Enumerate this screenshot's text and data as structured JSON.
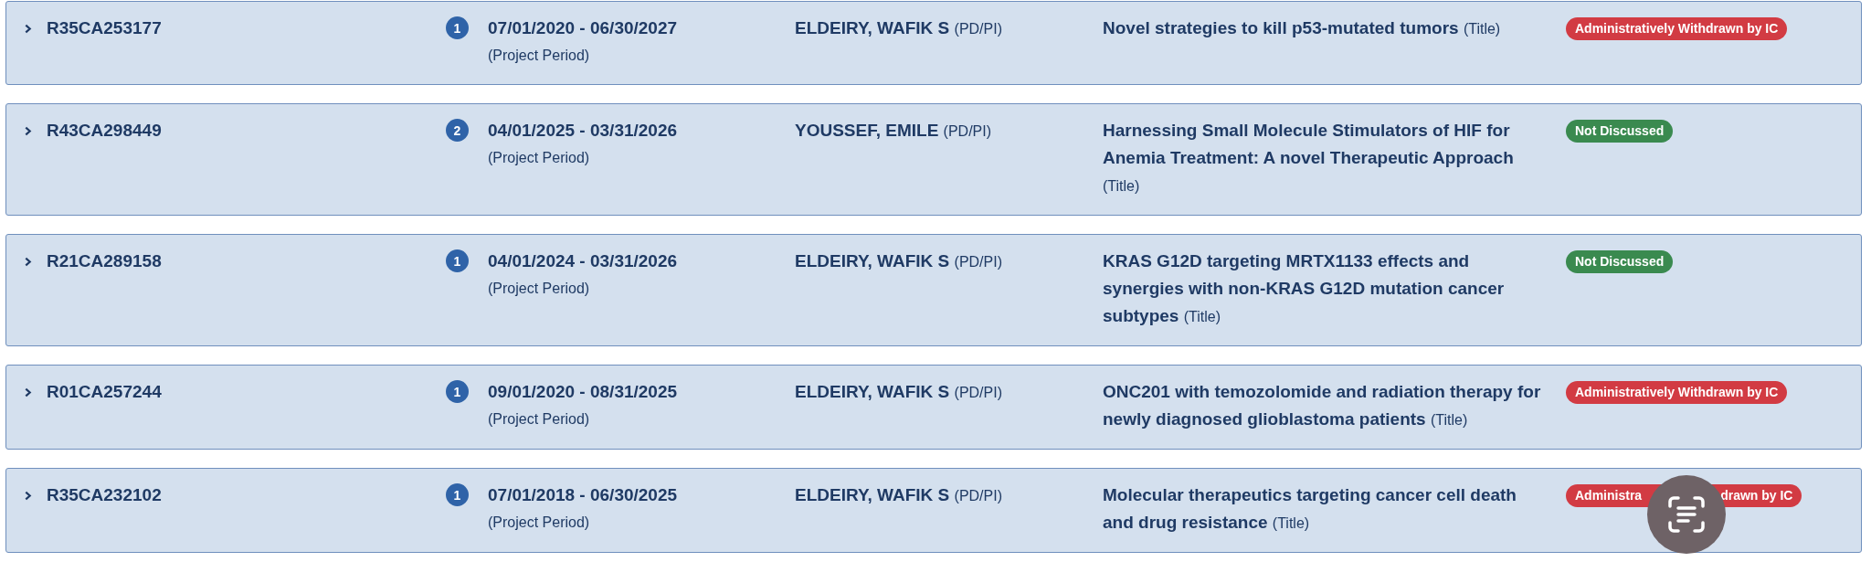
{
  "grants": [
    {
      "id": "R35CA253177",
      "expanded": false,
      "count": "1",
      "period": "07/01/2020 - 06/30/2027",
      "period_note": "(Project Period)",
      "pi": "ELDEIRY, WAFIK S",
      "pi_role": "(PD/PI)",
      "title": "Novel strategies to kill p53-mutated tumors",
      "title_note": "(Title)",
      "status": {
        "kind": "withdrawn",
        "label": "Administratively Withdrawn by IC"
      }
    },
    {
      "id": "R43CA298449",
      "expanded": false,
      "count": "2",
      "period": "04/01/2025 - 03/31/2026",
      "period_note": "(Project Period)",
      "pi": "YOUSSEF, EMILE",
      "pi_role": "(PD/PI)",
      "title": "Harnessing Small Molecule Stimulators of HIF for Anemia Treatment: A novel Therapeutic Approach",
      "title_note": "(Title)",
      "status": {
        "kind": "not_discussed",
        "label": "Not Discussed"
      }
    },
    {
      "id": "R21CA289158",
      "expanded": false,
      "count": "1",
      "period": "04/01/2024 - 03/31/2026",
      "period_note": "(Project Period)",
      "pi": "ELDEIRY, WAFIK S",
      "pi_role": "(PD/PI)",
      "title": "KRAS G12D targeting MRTX1133 effects and synergies with non-KRAS G12D mutation cancer subtypes",
      "title_note": "(Title)",
      "status": {
        "kind": "not_discussed",
        "label": "Not Discussed"
      }
    },
    {
      "id": "R01CA257244",
      "expanded": false,
      "count": "1",
      "period": "09/01/2020 - 08/31/2025",
      "period_note": "(Project Period)",
      "pi": "ELDEIRY, WAFIK S",
      "pi_role": "(PD/PI)",
      "title": "ONC201 with temozolomide and radiation therapy for newly diagnosed glioblastoma patients",
      "title_note": "(Title)",
      "status": {
        "kind": "withdrawn",
        "label": "Administratively Withdrawn by IC"
      }
    },
    {
      "id": "R35CA232102",
      "expanded": false,
      "count": "1",
      "period": "07/01/2018 - 06/30/2025",
      "period_note": "(Project Period)",
      "pi": "ELDEIRY, WAFIK S",
      "pi_role": "(PD/PI)",
      "title": "Molecular therapeutics targeting cancer cell death and drug resistance",
      "title_note": "(Title)",
      "status": {
        "kind": "withdrawn",
        "label_before": "Administra",
        "label_after": "drawn by IC"
      }
    }
  ],
  "overlay_button": {
    "kind": "text_scan"
  }
}
